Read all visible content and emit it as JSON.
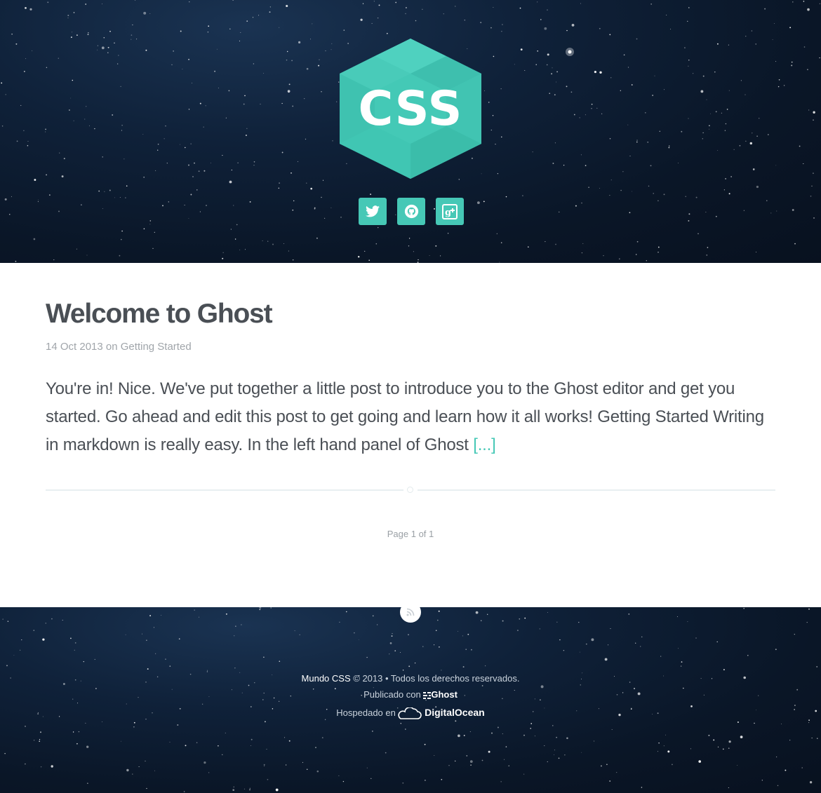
{
  "header": {
    "logo_text": "CSS",
    "social": [
      {
        "icon": "twitter-icon"
      },
      {
        "icon": "github-icon"
      },
      {
        "icon": "google-plus-icon"
      }
    ]
  },
  "post": {
    "title": "Welcome to Ghost",
    "date": "14 Oct 2013",
    "meta_on": "on",
    "tag": "Getting Started",
    "excerpt": "You're in! Nice. We've put together a little post to introduce you to the Ghost editor and get you started. Go ahead and edit this post to get going and learn how it all works! Getting Started Writing in markdown is really easy. In the left hand panel of Ghost",
    "read_more": "[...]"
  },
  "pagination": {
    "label": "Page 1 of 1"
  },
  "footer": {
    "rss_icon": "rss-icon",
    "site_name": "Mundo CSS",
    "copyright": "© 2013 • Todos los derechos reservados.",
    "published_label": "Publicado con",
    "ghost_brand": "Ghost",
    "hosted_label": "Hospedado en",
    "do_brand": "DigitalOcean"
  },
  "colors": {
    "accent": "#46c8b6",
    "text": "#4a4f55",
    "meta": "#a0a5aa",
    "space": "#0f2139"
  }
}
